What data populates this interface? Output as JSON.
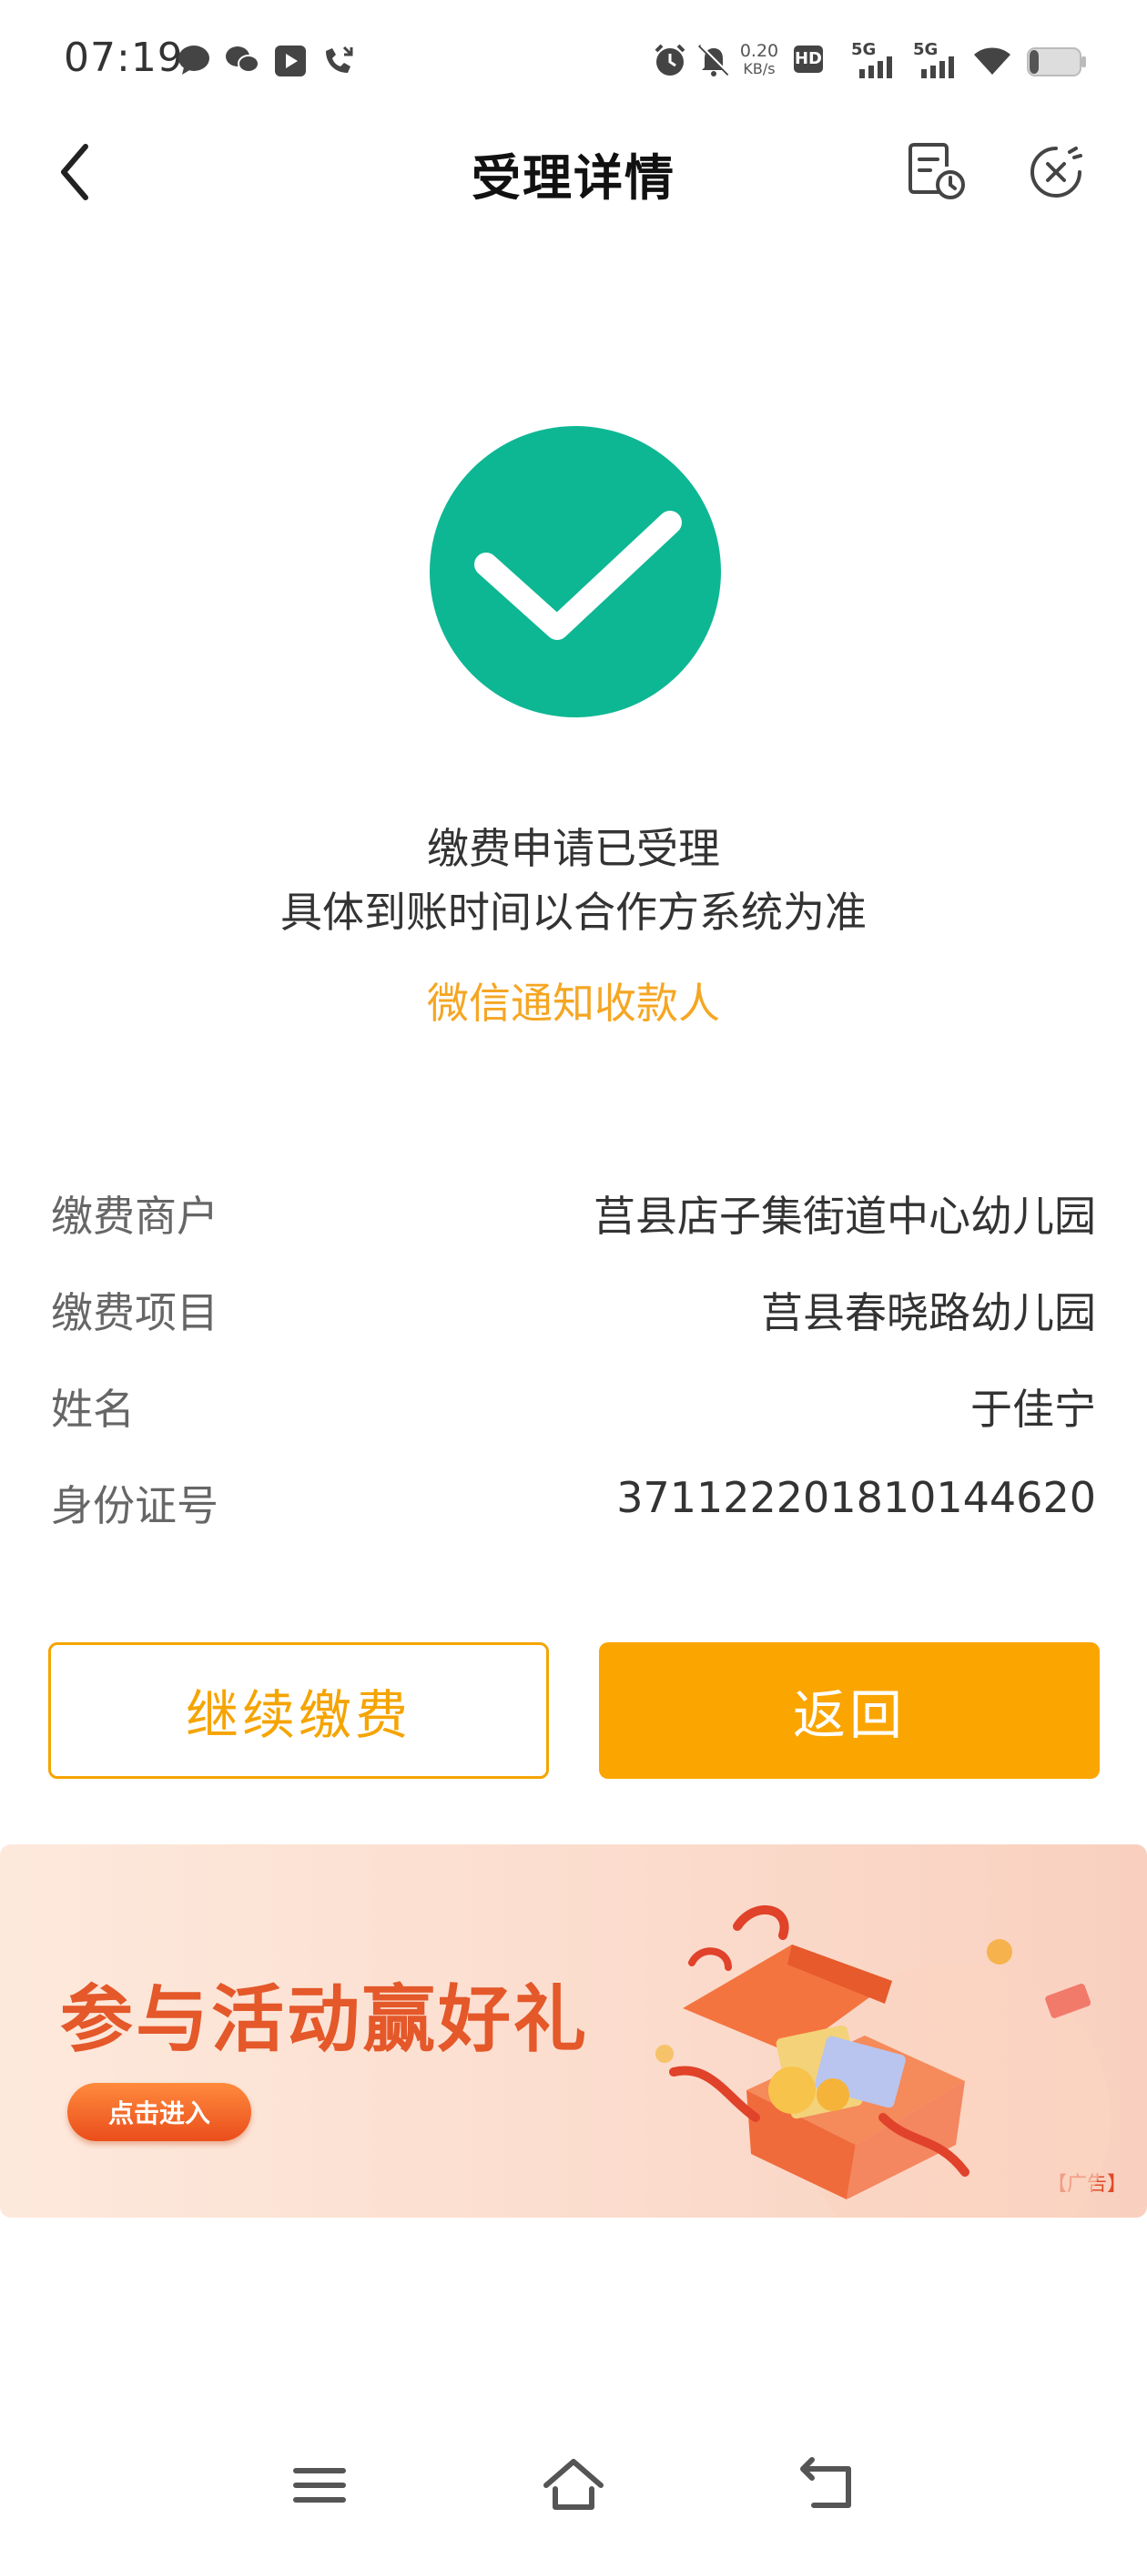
{
  "status_bar": {
    "time": "07:19",
    "net_speed_value": "0.20",
    "net_speed_unit": "KB/s",
    "hd_label": "HD",
    "sim1_label": "5G",
    "sim2_label": "5G",
    "icons": [
      "message-icon",
      "wechat-icon",
      "video-icon",
      "missed-call-icon",
      "alarm-icon",
      "mute-icon",
      "wifi-icon",
      "battery-icon"
    ]
  },
  "header": {
    "title": "受理详情",
    "icons": [
      "back-icon",
      "record-icon",
      "close-icon"
    ]
  },
  "result": {
    "line1": "缴费申请已受理",
    "line2": "具体到账时间以合作方系统为准",
    "notify_link": "微信通知收款人"
  },
  "details": [
    {
      "label": "缴费商户",
      "value": "莒县店子集街道中心幼儿园"
    },
    {
      "label": "缴费项目",
      "value": "莒县春晓路幼儿园"
    },
    {
      "label": "姓名",
      "value": "于佳宁"
    },
    {
      "label": "身份证号",
      "value": "371122201810144620"
    }
  ],
  "actions": {
    "continue_label": "继续缴费",
    "back_label": "返回"
  },
  "banner": {
    "title": "参与活动赢好礼",
    "button_label": "点击进入",
    "ad_tag": "【广告】"
  },
  "colors": {
    "success": "#0db793",
    "accent": "#f5a400",
    "banner_title": "#e4582a"
  }
}
